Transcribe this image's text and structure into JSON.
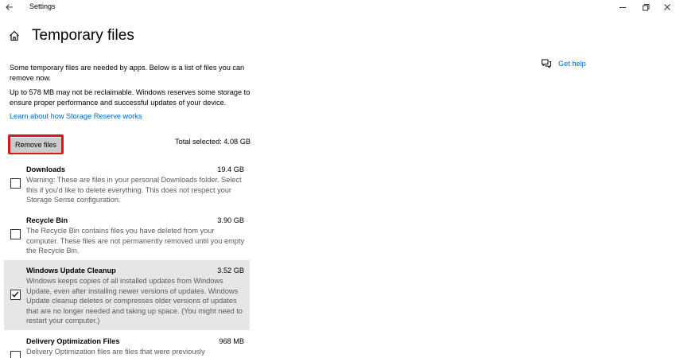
{
  "window": {
    "title": "Settings"
  },
  "page": {
    "title": "Temporary files"
  },
  "intro": {
    "text1": "Some temporary files are needed by apps. Below is a list of files you can remove now.",
    "text2": "Up to 578 MB may not be reclaimable. Windows reserves some storage to ensure proper performance and successful updates of your device.",
    "storage_reserve_link": "Learn about how Storage Reserve works"
  },
  "actions": {
    "remove_label": "Remove files",
    "total_selected": "Total selected: 4.08 GB"
  },
  "items": [
    {
      "name": "Downloads",
      "size": "19.4 GB",
      "description": "Warning: These are files in your personal Downloads folder. Select this if you'd like to delete everything. This does not respect your Storage Sense configuration.",
      "checked": false
    },
    {
      "name": "Recycle Bin",
      "size": "3.90 GB",
      "description": "The Recycle Bin contains files you have deleted from your computer. These files are not permanently removed until you empty the Recycle Bin.",
      "checked": false
    },
    {
      "name": "Windows Update Cleanup",
      "size": "3.52 GB",
      "description": "Windows keeps copies of all installed updates from Windows Update, even after installing newer versions of updates. Windows Update cleanup deletes or compresses older versions of updates that are no longer needed and taking up space. (You might need to restart your computer.)",
      "checked": true
    },
    {
      "name": "Delivery Optimization Files",
      "size": "968 MB",
      "description": "Delivery Optimization files are files that were previously",
      "checked": false
    }
  ],
  "help": {
    "label": "Get help"
  },
  "colors": {
    "link": "#0067c0",
    "highlight_border": "#d7171f",
    "selected_row": "#e6e6e6"
  }
}
